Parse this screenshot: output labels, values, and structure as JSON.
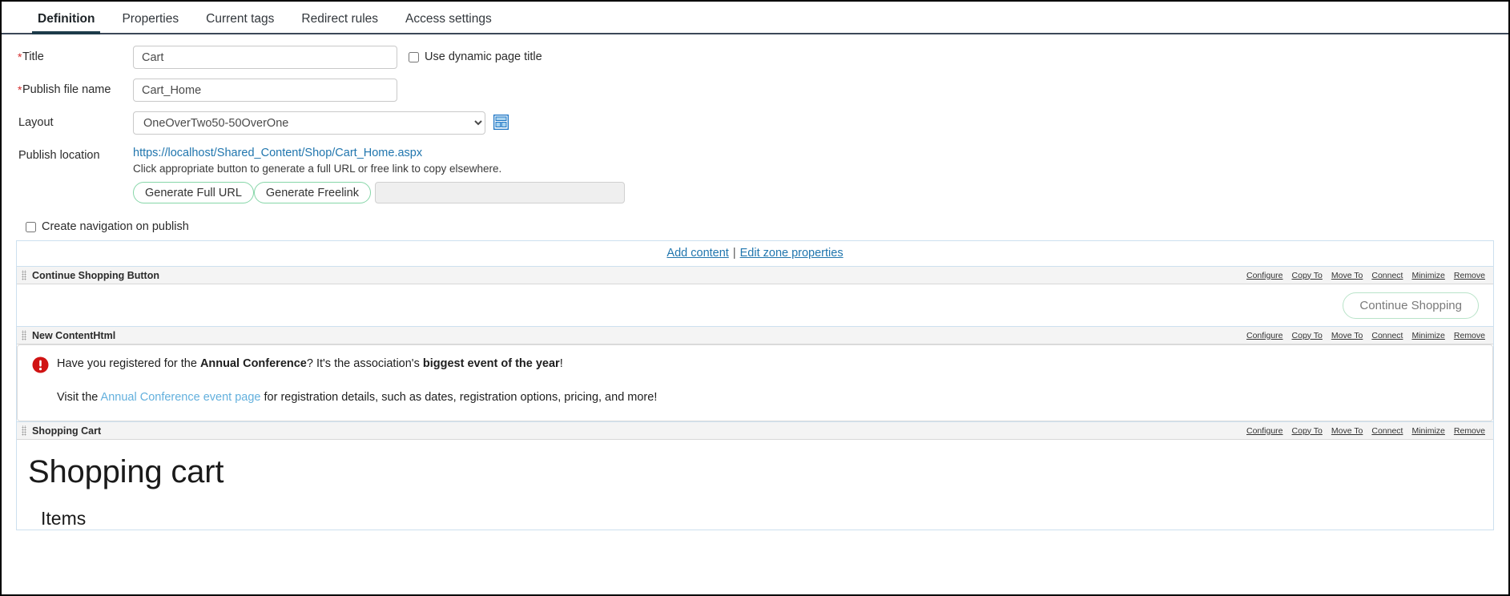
{
  "tabs": [
    {
      "label": "Definition",
      "active": true
    },
    {
      "label": "Properties",
      "active": false
    },
    {
      "label": "Current tags",
      "active": false
    },
    {
      "label": "Redirect rules",
      "active": false
    },
    {
      "label": "Access settings",
      "active": false
    }
  ],
  "form": {
    "title": {
      "label": "Title",
      "required": true,
      "value": "Cart",
      "placeholder": ""
    },
    "dynamic_title_checkbox": {
      "label": "Use dynamic page title",
      "checked": false
    },
    "publish_file_name": {
      "label": "Publish file name",
      "required": true,
      "value": "Cart_Home",
      "placeholder": ""
    },
    "layout": {
      "label": "Layout",
      "selected": "OneOverTwo50-50OverOne",
      "options": [
        "OneOverTwo50-50OverOne"
      ],
      "preview_icon": "layout-preview-icon"
    },
    "publish_location": {
      "label": "Publish location",
      "url": "https://localhost/Shared_Content/Shop/Cart_Home.aspx",
      "hint": "Click appropriate button to generate a full URL or free link to copy elsewhere.",
      "generate_full_url_label": "Generate Full URL",
      "generate_freelink_label": "Generate Freelink",
      "freelink_value": "",
      "freelink_placeholder": ""
    },
    "create_navigation_checkbox": {
      "label": "Create navigation on publish",
      "checked": false
    }
  },
  "zone_toolbar": {
    "add_content": "Add content",
    "separator": "|",
    "edit_zone_properties": "Edit zone properties"
  },
  "widget_actions": [
    "Configure",
    "Copy To",
    "Move To",
    "Connect",
    "Minimize",
    "Remove"
  ],
  "widgets": [
    {
      "title": "Continue Shopping Button",
      "type": "button",
      "button_label": "Continue Shopping"
    },
    {
      "title": "New ContentHtml",
      "type": "html",
      "alert_icon": "error-circle-icon",
      "alert_text_1": "Have you registered for the ",
      "alert_bold_1": "Annual Conference",
      "alert_text_2": "? It's the association's ",
      "alert_bold_2": "biggest event of the year",
      "alert_text_3": "!",
      "sub_text_1": "Visit the ",
      "sub_link": "Annual Conference event page",
      "sub_text_2": " for registration details, such as dates, registration options, pricing, and more!"
    },
    {
      "title": "Shopping Cart",
      "type": "cart",
      "heading": "Shopping cart",
      "subheading": "Items"
    }
  ],
  "colors": {
    "tab_underline": "#1d3b4a",
    "link": "#2176ae",
    "required_star": "#d32c2c",
    "alert_red": "#d01313",
    "button_green_border": "#86d6a8",
    "zone_border": "#cde0ef",
    "icon_blue": "#1b74c4"
  }
}
